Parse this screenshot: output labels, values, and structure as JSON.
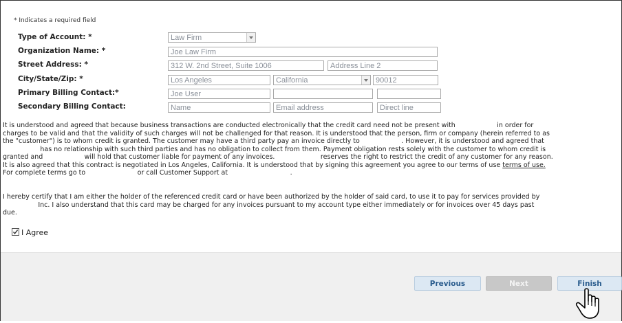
{
  "required_note": "* Indicates a required field",
  "form": {
    "account_type": {
      "label": "Type of Account: *",
      "value": "Law Firm"
    },
    "organization": {
      "label": "Organization Name: *",
      "value": "Joe Law Firm"
    },
    "street": {
      "label": "Street Address: *",
      "line1": "312 W. 2nd Street, Suite 1006",
      "line2_placeholder": "Address Line 2"
    },
    "city_state_zip": {
      "label": "City/State/Zip: *",
      "city": "Los Angeles",
      "state": "California",
      "zip": "90012"
    },
    "primary_contact": {
      "label": "Primary Billing Contact:*",
      "name": "Joe User",
      "email": "",
      "phone": ""
    },
    "secondary_contact": {
      "label": "Secondary Billing Contact:",
      "name_placeholder": "Name",
      "email_placeholder": "Email address",
      "phone_placeholder": "Direct line"
    }
  },
  "agreement": {
    "p1_lines": [
      "It is understood and agreed that because business transactions are conducted electronically that the credit card need not be present with                    in order for",
      "charges to be valid and that the validity of such charges will not be challenged for that reason. It is understood that the person, firm or company (herein referred to as",
      "the \"customer\") is to whom credit is granted. The customer may have a third party pay an invoice directly to                    . However, it is understood and agreed that",
      "                  has no relationship with such third parties and has no obligation to collect from them. Payment obligation rests solely with the customer to whom credit is",
      "granted and                    will hold that customer liable for payment of any invoices.                      reserves the right to restrict the credit of any customer for any reason.",
      "It is also agreed that this contract is negotiated in Los Angeles, California. It is understood that by signing this agreement you agree to our terms of use"
    ],
    "terms_link": "terms of use.",
    "p1_last_line": "For complete terms go to                         or call Customer Support at                              .",
    "p2_lines": [
      "I hereby certify that I am either the holder of the referenced credit card or have been authorized by the holder of said card, to use it to pay for services provided by",
      "                 Inc. I also understand that this card may be charged for any invoices pursuant to my account type either immediately or for invoices over 45 days past",
      "due."
    ]
  },
  "agree_label": "I Agree",
  "agree_checked": true,
  "buttons": {
    "previous": "Previous",
    "next": "Next",
    "finish": "Finish"
  }
}
